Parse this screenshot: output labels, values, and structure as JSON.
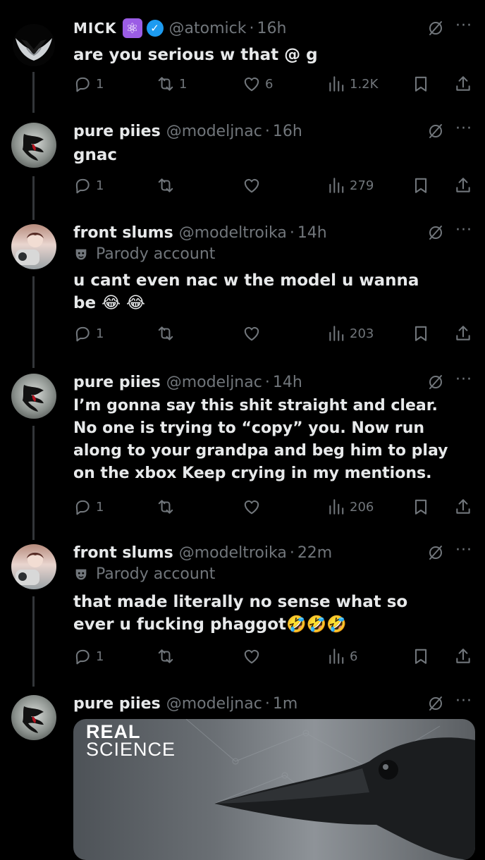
{
  "tweets": [
    {
      "name": "MICK",
      "handle": "@atomick",
      "time": "16h",
      "text": "are you serious w that @ g",
      "replies": "1",
      "retweets": "1",
      "likes": "6",
      "views": "1.2K",
      "badges": [
        "atom-emoji",
        "verified-badge"
      ]
    },
    {
      "name": "pure piies",
      "handle": "@modeljnac",
      "time": "16h",
      "text": "gnac",
      "replies": "1",
      "retweets": "",
      "likes": "",
      "views": "279"
    },
    {
      "name": "front slums",
      "handle": "@modeltroika",
      "time": "14h",
      "parody": "Parody account",
      "text": "u cant even nac w the model u wanna be 😂 😂",
      "replies": "1",
      "retweets": "",
      "likes": "",
      "views": "203"
    },
    {
      "name": "pure piies",
      "handle": "@modeljnac",
      "time": "14h",
      "text": "I’m gonna say this shit straight and clear. No one is trying to “copy” you. Now run along to your grandpa and beg him to play on the xbox Keep crying in my mentions.",
      "replies": "1",
      "retweets": "",
      "likes": "",
      "views": "206"
    },
    {
      "name": "front slums",
      "handle": "@modeltroika",
      "time": "22m",
      "parody": "Parody account",
      "text": "that made literally no sense what so ever u fucking phaggot🤣🤣🤣",
      "replies": "1",
      "retweets": "",
      "likes": "",
      "views": "6"
    },
    {
      "name": "pure piies",
      "handle": "@modeljnac",
      "time": "1m",
      "media": {
        "title_line1": "REAL",
        "title_line2": "SCIENCE",
        "image": "crow-photo"
      }
    }
  ],
  "separator": "·",
  "icons": {
    "reply": "reply-icon",
    "retweet": "retweet-icon",
    "like": "heart-icon",
    "views": "views-icon",
    "bookmark": "bookmark-icon",
    "share": "share-icon",
    "grok": "grok-icon",
    "more": "more-icon"
  },
  "colors": {
    "background": "#000000",
    "text": "#e7e9ea",
    "muted": "#71767b",
    "verified": "#1d9bf0",
    "atom_badge": "#9b5de5"
  }
}
